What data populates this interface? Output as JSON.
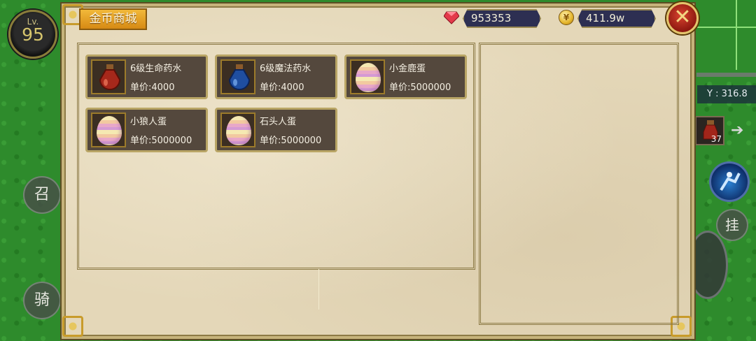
{
  "hud": {
    "level_label": "Lv.",
    "level_value": "95",
    "summon_label": "召",
    "ride_label": "骑",
    "auto_label": "挂",
    "y_coord": "Y : 316.8",
    "quick_slot_count": "37"
  },
  "shop": {
    "title": "金币商城",
    "gems": "953353",
    "gold": "411.9w",
    "items": [
      {
        "name": "6级生命药水",
        "price_label": "单价:",
        "price": "4000",
        "icon": "red-potion-icon"
      },
      {
        "name": "6级魔法药水",
        "price_label": "单价:",
        "price": "4000",
        "icon": "blue-potion-icon"
      },
      {
        "name": "小金鹿蛋",
        "price_label": "单价:",
        "price": "5000000",
        "icon": "egg-icon"
      },
      {
        "name": "小狼人蛋",
        "price_label": "单价:",
        "price": "5000000",
        "icon": "egg-icon"
      },
      {
        "name": "石头人蛋",
        "price_label": "单价:",
        "price": "5000000",
        "icon": "egg-icon"
      }
    ]
  },
  "colors": {
    "panel_bg": "#e4d7b8",
    "card_bg": "#54483d",
    "title_tab": "#e9a52a",
    "currency_bg": "#2d2f52",
    "close_red": "#b62a1c"
  }
}
